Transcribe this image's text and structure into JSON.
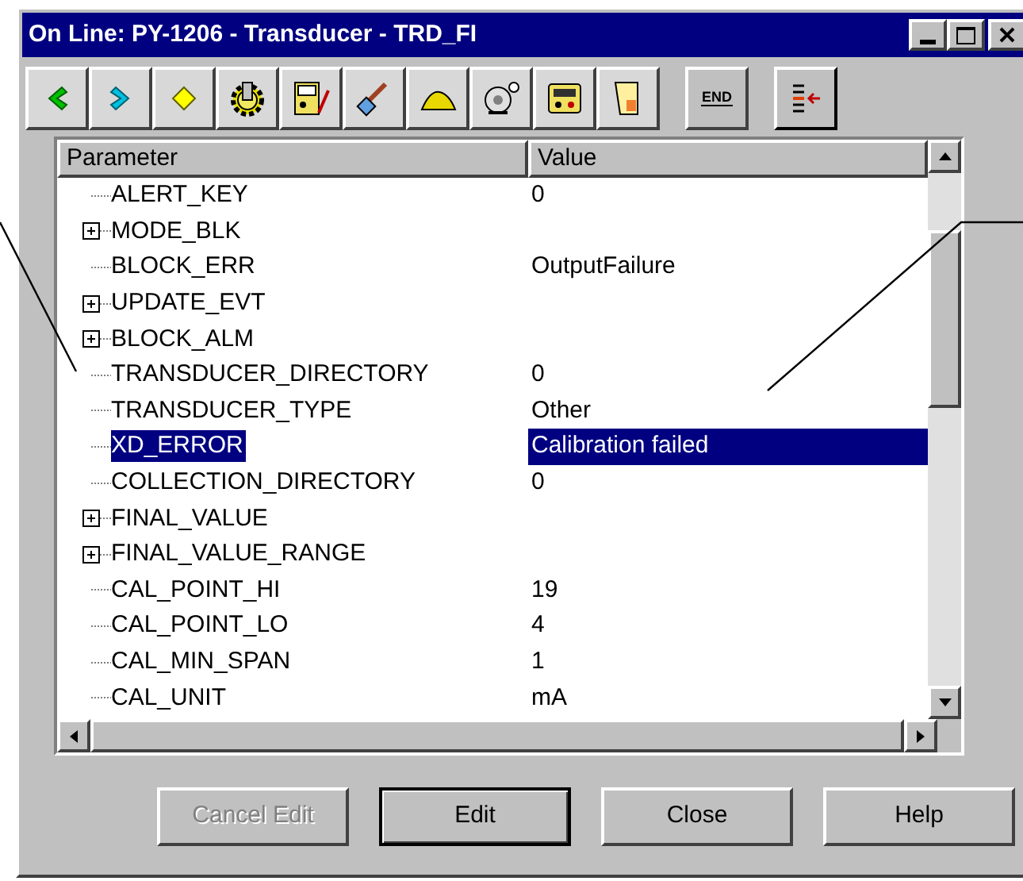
{
  "window": {
    "title": "On Line: PY-1206 - Transducer - TRD_FI"
  },
  "toolbar": [
    {
      "kind": "back"
    },
    {
      "kind": "forward"
    },
    {
      "kind": "diamond"
    },
    {
      "kind": "gear"
    },
    {
      "kind": "meter"
    },
    {
      "kind": "probe"
    },
    {
      "kind": "mound"
    },
    {
      "kind": "bell"
    },
    {
      "kind": "device"
    },
    {
      "kind": "scroll"
    },
    {
      "kind": "end",
      "label": "END"
    },
    {
      "kind": "list"
    }
  ],
  "table": {
    "columns": [
      "Parameter",
      "Value"
    ],
    "rows": [
      {
        "name": "ALERT_KEY",
        "value": "0",
        "kind": "leaf",
        "selected": false
      },
      {
        "name": "MODE_BLK",
        "kind": "group",
        "expanded": false,
        "selected": false
      },
      {
        "name": "BLOCK_ERR",
        "value": "OutputFailure",
        "kind": "leaf",
        "selected": false
      },
      {
        "name": "UPDATE_EVT",
        "kind": "group",
        "expanded": false,
        "selected": false
      },
      {
        "name": "BLOCK_ALM",
        "kind": "group",
        "expanded": false,
        "selected": false
      },
      {
        "name": "TRANSDUCER_DIRECTORY",
        "value": "0",
        "kind": "leaf",
        "selected": false
      },
      {
        "name": "TRANSDUCER_TYPE",
        "value": "Other",
        "kind": "leaf",
        "selected": false
      },
      {
        "name": "XD_ERROR",
        "value": "Calibration failed",
        "kind": "leaf",
        "selected": true
      },
      {
        "name": "COLLECTION_DIRECTORY",
        "value": "0",
        "kind": "leaf",
        "selected": false
      },
      {
        "name": "FINAL_VALUE",
        "kind": "group",
        "expanded": false,
        "selected": false
      },
      {
        "name": "FINAL_VALUE_RANGE",
        "kind": "group",
        "expanded": false,
        "selected": false
      },
      {
        "name": "CAL_POINT_HI",
        "value": "19",
        "kind": "leaf",
        "selected": false
      },
      {
        "name": "CAL_POINT_LO",
        "value": "4",
        "kind": "leaf",
        "selected": false
      },
      {
        "name": "CAL_MIN_SPAN",
        "value": "1",
        "kind": "leaf",
        "selected": false
      },
      {
        "name": "CAL_UNIT",
        "value": "mA",
        "kind": "leaf",
        "selected": false
      }
    ]
  },
  "buttons": [
    {
      "label": "Cancel Edit",
      "disabled": true,
      "default": false
    },
    {
      "label": "Edit",
      "disabled": false,
      "default": true
    },
    {
      "label": "Close",
      "disabled": false,
      "default": false
    },
    {
      "label": "Help",
      "disabled": false,
      "default": false
    }
  ]
}
